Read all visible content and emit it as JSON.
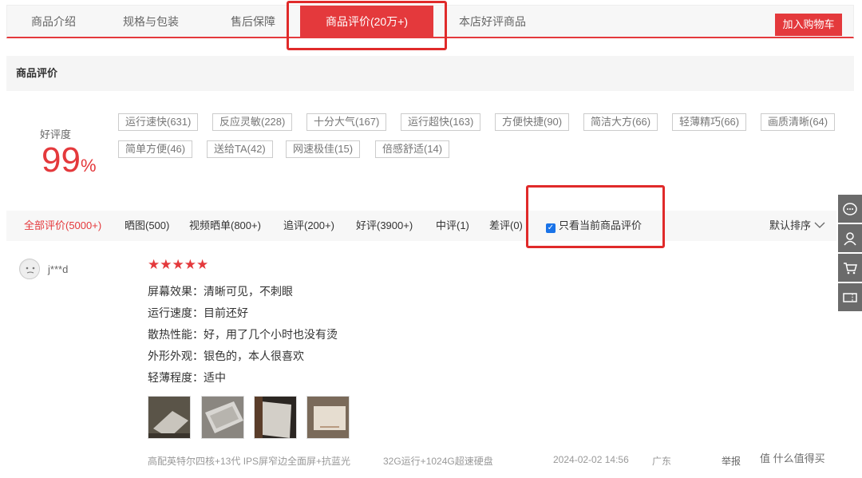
{
  "tabs": [
    {
      "label": "商品介绍"
    },
    {
      "label": "规格与包装"
    },
    {
      "label": "售后保障"
    },
    {
      "label": "商品评价(20万+)"
    },
    {
      "label": "本店好评商品"
    }
  ],
  "cart_button": "加入购物车",
  "section_title": "商品评价",
  "rating": {
    "label": "好评度",
    "value": "99",
    "unit": "%"
  },
  "tags": [
    "运行速快(631)",
    "反应灵敏(228)",
    "十分大气(167)",
    "运行超快(163)",
    "方便快捷(90)",
    "简洁大方(66)",
    "轻薄精巧(66)",
    "画质清晰(64)",
    "简单方便(46)",
    "送给TA(42)",
    "网速极佳(15)",
    "倍感舒适(14)"
  ],
  "filters": [
    {
      "label": "全部评价(5000+)"
    },
    {
      "label": "晒图(500)"
    },
    {
      "label": "视频晒单(800+)"
    },
    {
      "label": "追评(200+)"
    },
    {
      "label": "好评(3900+)"
    },
    {
      "label": "中评(1)"
    },
    {
      "label": "差评(0)"
    }
  ],
  "only_current_label": "只看当前商品评价",
  "sort_label": "默认排序",
  "review": {
    "username": "j***d",
    "stars": "★★★★★",
    "lines": [
      "屏幕效果：清晰可见，不刺眼",
      "运行速度：目前还好",
      "散热性能：好，用了几个小时也没有烫",
      "外形外观：银色的，本人很喜欢",
      "轻薄程度：适中"
    ],
    "spec": "高配英特尔四核+13代 IPS屏窄边全面屏+抗蓝光",
    "storage": "32G运行+1024G超速硬盘",
    "date": "2024-02-02 14:56",
    "region": "广东",
    "report": "举报"
  },
  "watermark": "值 什么值得买",
  "colors": {
    "accent": "#e4393c",
    "checkbox": "#1a73e8",
    "sidebar": "#6b6b6b"
  },
  "icons": [
    "chat-icon",
    "user-icon",
    "cart-icon",
    "coupon-icon",
    "chevron-down-icon",
    "checkbox-checked-icon",
    "star-icon"
  ]
}
